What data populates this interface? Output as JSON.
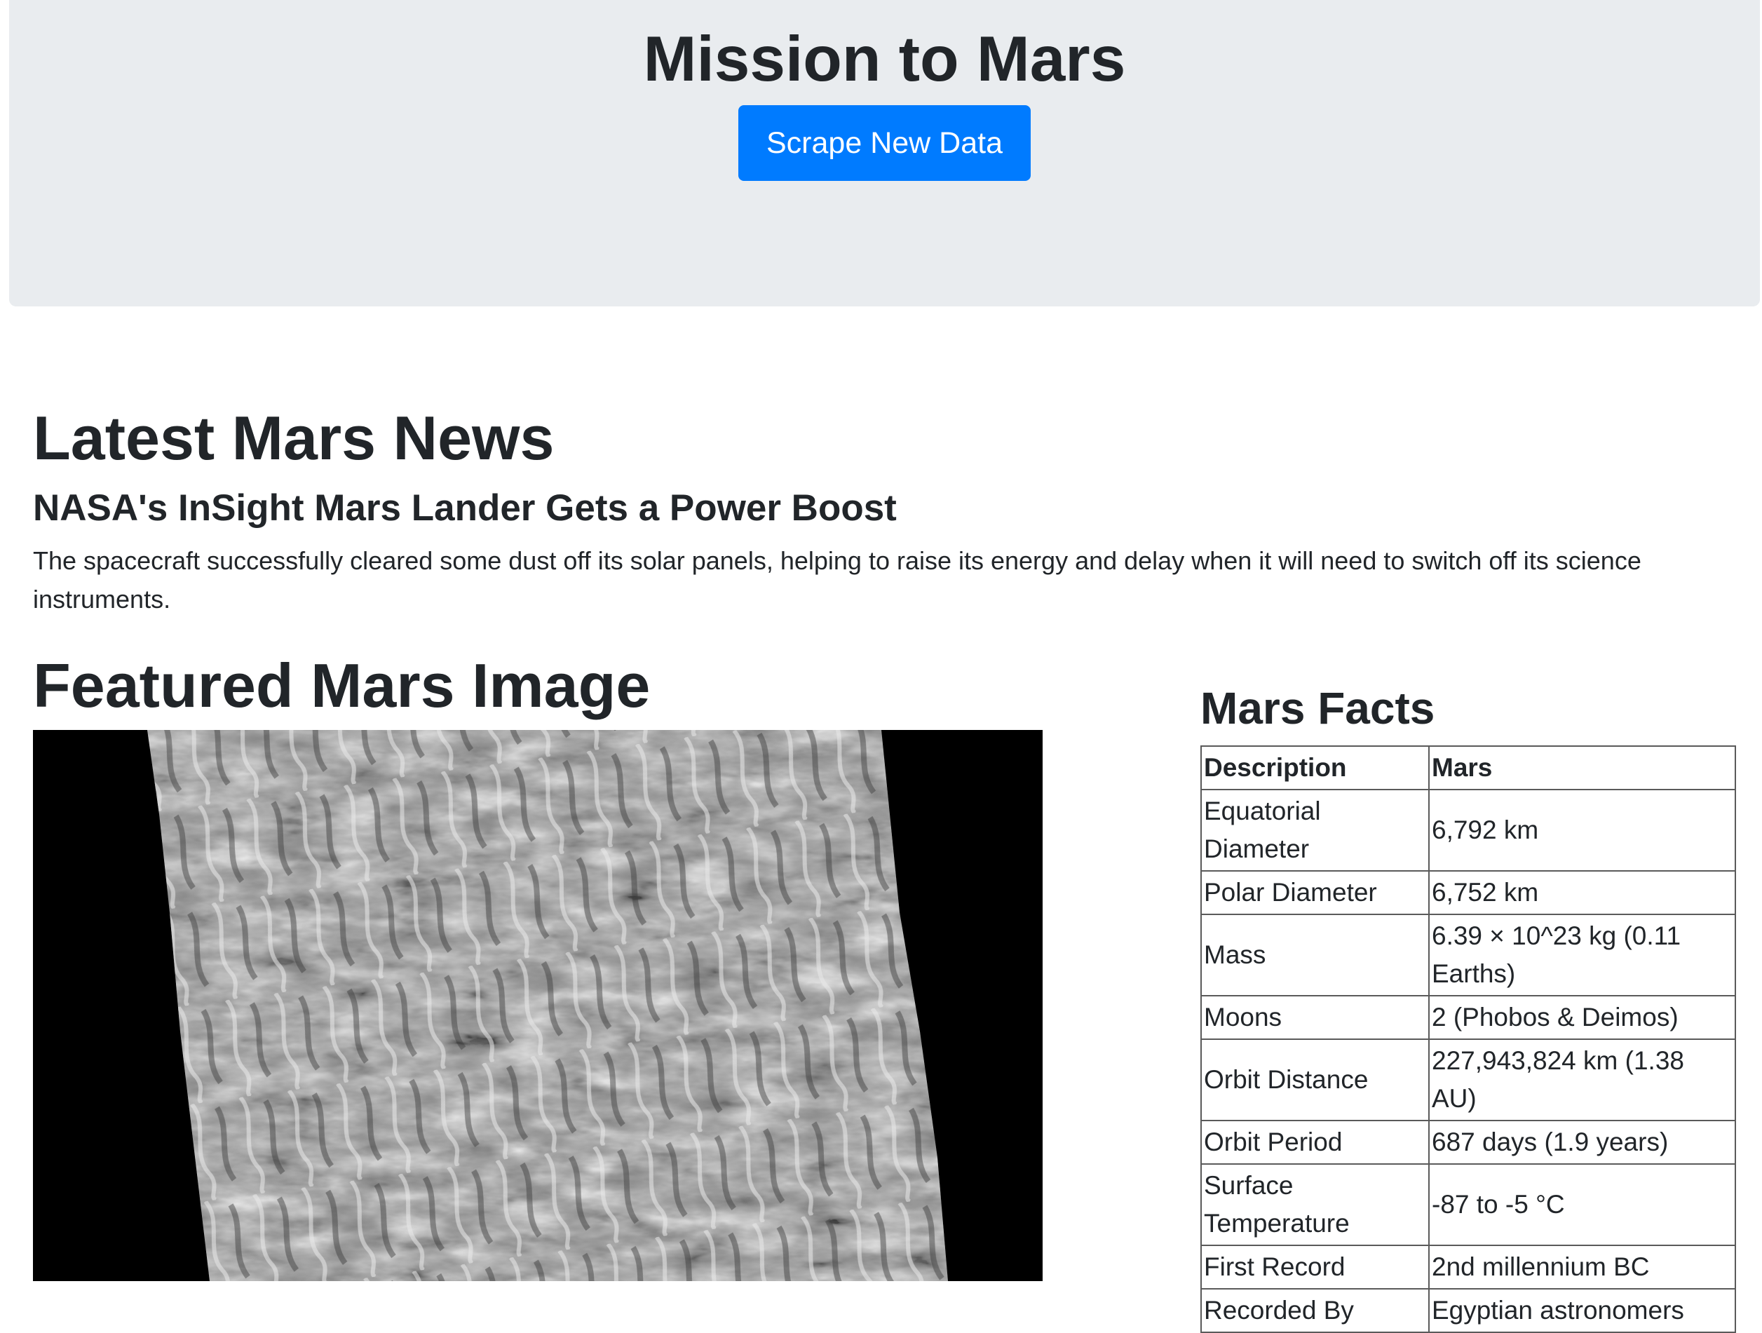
{
  "header": {
    "title": "Mission to Mars",
    "scrape_button_label": "Scrape New Data"
  },
  "news": {
    "heading": "Latest Mars News",
    "title": "NASA's InSight Mars Lander Gets a Power Boost",
    "teaser": "The spacecraft successfully cleared some dust off its solar panels, helping to raise its energy and delay when it will need to switch off its science instruments."
  },
  "featured": {
    "heading": "Featured Mars Image"
  },
  "facts": {
    "heading": "Mars Facts",
    "columns": [
      "Description",
      "Mars"
    ],
    "rows": [
      [
        "Equatorial Diameter",
        "6,792 km"
      ],
      [
        "Polar Diameter",
        "6,752 km"
      ],
      [
        "Mass",
        "6.39 × 10^23 kg (0.11 Earths)"
      ],
      [
        "Moons",
        "2 (Phobos & Deimos)"
      ],
      [
        "Orbit Distance",
        "227,943,824 km (1.38 AU)"
      ],
      [
        "Orbit Period",
        "687 days (1.9 years)"
      ],
      [
        "Surface Temperature",
        "-87 to -5 °C"
      ],
      [
        "First Record",
        "2nd millennium BC"
      ],
      [
        "Recorded By",
        "Egyptian astronomers"
      ]
    ]
  },
  "colors": {
    "jumbotron_bg": "#e9ecef",
    "primary": "#007bff",
    "text": "#212529"
  }
}
